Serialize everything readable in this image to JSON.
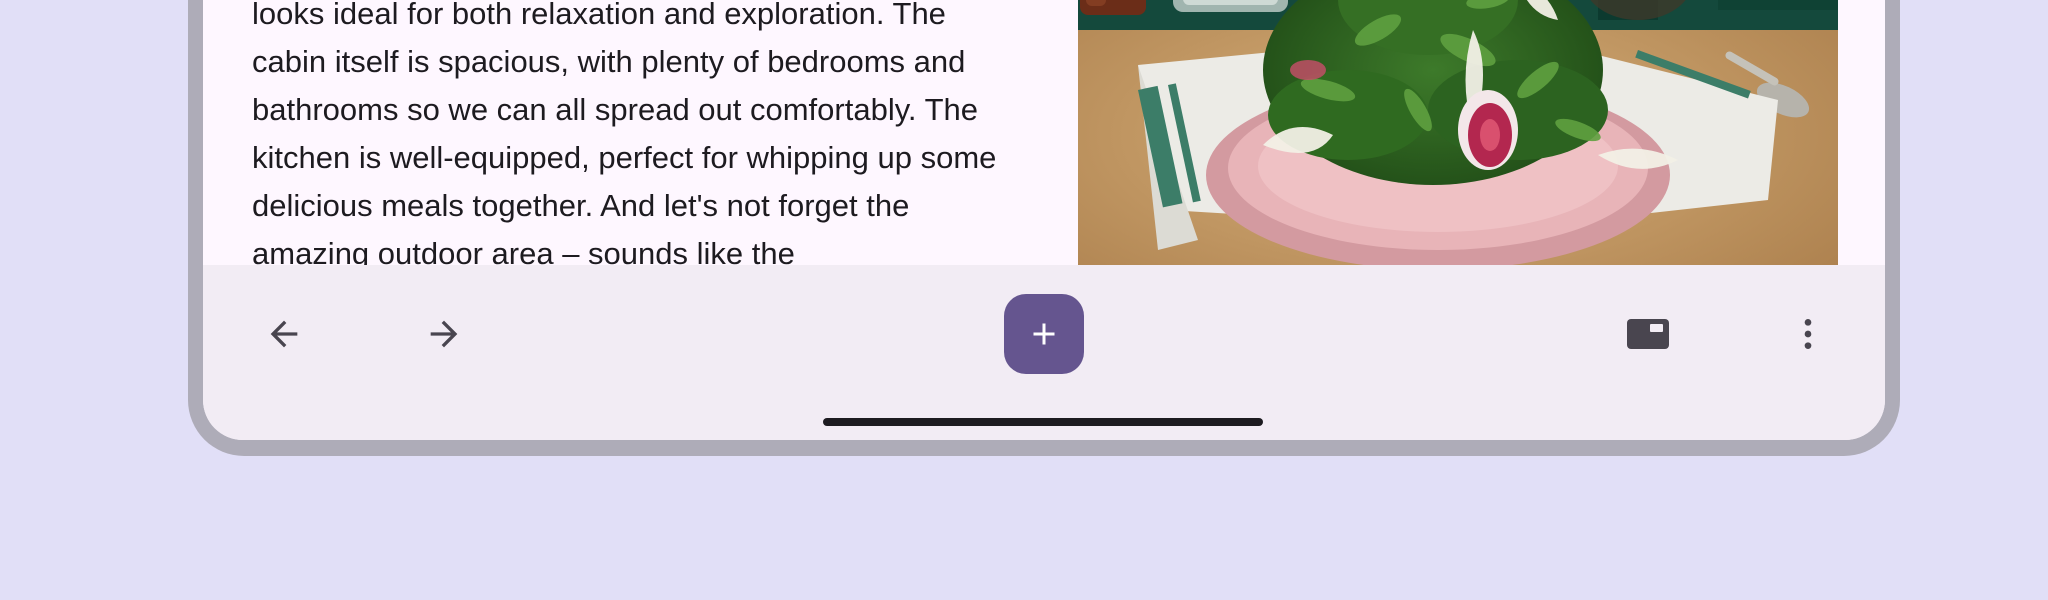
{
  "article": {
    "text": "looks ideal for both relaxation and exploration. The cabin itself is spacious, with plenty of bedrooms and bathrooms so we can all spread out comfortably. The kitchen is well-equipped, perfect for whipping up some delicious meals together. And let's not forget the amazing outdoor area – sounds like the"
  },
  "image": {
    "subject": "arugula salad on pink plate"
  },
  "bottom_bar": {
    "icons": {
      "back": "arrow-back-icon",
      "forward": "arrow-forward-icon",
      "add": "add-icon",
      "tabs": "tab-switcher-icon",
      "more": "more-vert-icon"
    }
  },
  "colors": {
    "background": "#e1dff7",
    "surface": "#fef7ff",
    "bar": "#f2ecf4",
    "accent": "#65558f",
    "text": "#1d1b20",
    "icon": "#49454f"
  }
}
